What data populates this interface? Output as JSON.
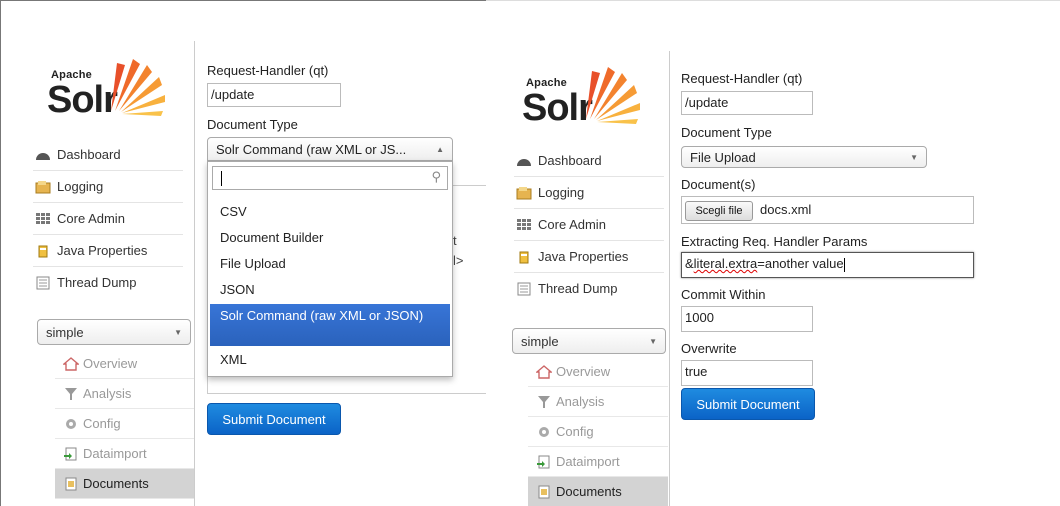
{
  "logo": {
    "apache": "Apache",
    "solr": "Solr"
  },
  "nav": [
    {
      "label": "Dashboard",
      "icon": "dashboard-icon"
    },
    {
      "label": "Logging",
      "icon": "logging-icon"
    },
    {
      "label": "Core Admin",
      "icon": "core-admin-icon"
    },
    {
      "label": "Java Properties",
      "icon": "java-icon"
    },
    {
      "label": "Thread Dump",
      "icon": "thread-dump-icon"
    }
  ],
  "core_selector": {
    "value": "simple"
  },
  "core_menu": [
    {
      "label": "Overview",
      "icon": "overview-icon"
    },
    {
      "label": "Analysis",
      "icon": "analysis-icon"
    },
    {
      "label": "Config",
      "icon": "config-icon"
    },
    {
      "label": "Dataimport",
      "icon": "dataimport-icon"
    },
    {
      "label": "Documents",
      "icon": "documents-icon"
    }
  ],
  "left_form": {
    "request_handler_label": "Request-Handler (qt)",
    "request_handler_value": "/update",
    "document_type_label": "Document Type",
    "document_type_value": "Solr Command (raw XML or JS...",
    "dropdown_options": [
      "CSV",
      "Document Builder",
      "File Upload",
      "JSON",
      "Solr Command (raw XML or JSON)",
      "XML"
    ],
    "selected_option": "Solr Command (raw XML or JSON)",
    "partial_text_1": "t",
    "partial_text_2": "l>",
    "submit_label": "Submit Document"
  },
  "right_form": {
    "request_handler_label": "Request-Handler (qt)",
    "request_handler_value": "/update",
    "document_type_label": "Document Type",
    "document_type_value": "File Upload",
    "documents_label": "Document(s)",
    "choose_file_label": "Scegli file",
    "file_name": "docs.xml",
    "extracting_label": "Extracting Req. Handler Params",
    "extracting_value_prefix": "&",
    "extracting_value_misspelled": "literal.extra",
    "extracting_value_suffix": "=another value",
    "commit_within_label": "Commit Within",
    "commit_within_value": "1000",
    "overwrite_label": "Overwrite",
    "overwrite_value": "true",
    "submit_label": "Submit Document"
  },
  "colors": {
    "accent": "#1a7fd8",
    "selected": "#3875d7",
    "active_nav": "#d3d3d3"
  }
}
